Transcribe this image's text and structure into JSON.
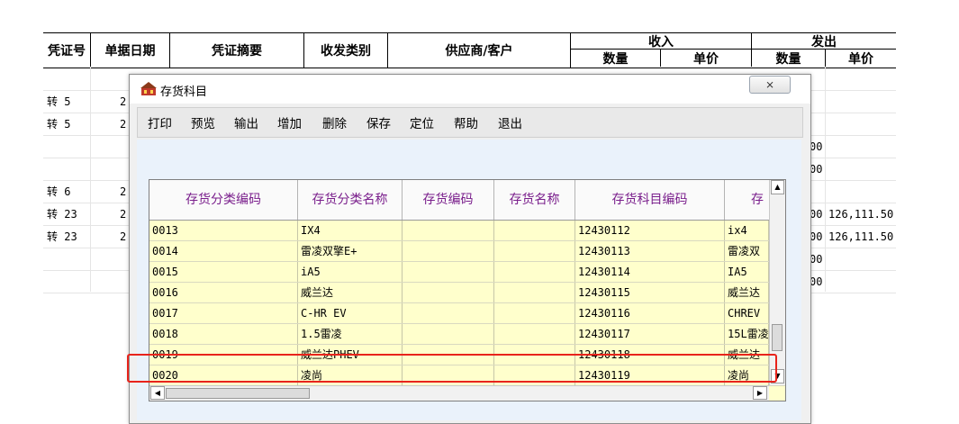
{
  "ledger": {
    "headers": {
      "voucher_no": "凭证号",
      "doc_date": "单据日期",
      "summary": "凭证摘要",
      "txn_type": "收发类别",
      "party": "供应商/客户",
      "income": "收入",
      "issue": "发出",
      "qty": "数量",
      "unit_price": "单价"
    },
    "rows": [
      {
        "voucher": "",
        "date": "",
        "tail": "",
        "price": ""
      },
      {
        "voucher": "转 5",
        "date": "2",
        "tail": "",
        "price": ""
      },
      {
        "voucher": "转 5",
        "date": "2",
        "tail": "",
        "price": ""
      },
      {
        "voucher": "",
        "date": "",
        "tail": "00",
        "price": ""
      },
      {
        "voucher": "",
        "date": "",
        "tail": "00",
        "price": ""
      },
      {
        "voucher": "转 6",
        "date": "2",
        "tail": "",
        "price": ""
      },
      {
        "voucher": "转 23",
        "date": "2",
        "tail": "00",
        "price": "126,111.50"
      },
      {
        "voucher": "转 23",
        "date": "2",
        "tail": "00",
        "price": "126,111.50"
      },
      {
        "voucher": "",
        "date": "",
        "tail": "00",
        "price": ""
      },
      {
        "voucher": "",
        "date": "",
        "tail": "00",
        "price": ""
      }
    ]
  },
  "dialog": {
    "title": "存货科目",
    "close_label": "⨯",
    "toolbar": [
      "打印",
      "预览",
      "输出",
      "增加",
      "删除",
      "保存",
      "定位",
      "帮助",
      "退出"
    ],
    "columns": [
      "存货分类编码",
      "存货分类名称",
      "存货编码",
      "存货名称",
      "存货科目编码",
      "存"
    ],
    "rows": [
      {
        "cat_code": "0013",
        "cat_name": "IX4",
        "inv_code": "",
        "inv_name": "",
        "subj_code": "12430112",
        "subj_name": "ix4"
      },
      {
        "cat_code": "0014",
        "cat_name": "雷凌双擎E+",
        "inv_code": "",
        "inv_name": "",
        "subj_code": "12430113",
        "subj_name": "雷凌双"
      },
      {
        "cat_code": "0015",
        "cat_name": "iA5",
        "inv_code": "",
        "inv_name": "",
        "subj_code": "12430114",
        "subj_name": "IA5"
      },
      {
        "cat_code": "0016",
        "cat_name": "威兰达",
        "inv_code": "",
        "inv_name": "",
        "subj_code": "12430115",
        "subj_name": "威兰达"
      },
      {
        "cat_code": "0017",
        "cat_name": "C-HR EV",
        "inv_code": "",
        "inv_name": "",
        "subj_code": "12430116",
        "subj_name": "CHREV"
      },
      {
        "cat_code": "0018",
        "cat_name": "1.5雷凌",
        "inv_code": "",
        "inv_name": "",
        "subj_code": "12430117",
        "subj_name": "15L雷凌"
      },
      {
        "cat_code": "0019",
        "cat_name": "威兰达PHEV",
        "inv_code": "",
        "inv_name": "",
        "subj_code": "12430118",
        "subj_name": "威兰达"
      },
      {
        "cat_code": "0020",
        "cat_name": "凌尚",
        "inv_code": "",
        "inv_name": "",
        "subj_code": "12430119",
        "subj_name": "凌尚"
      }
    ]
  },
  "colors": {
    "header_text": "#7a1f8c",
    "grid_bg": "#ffffcc",
    "highlight": "#e8231b"
  }
}
